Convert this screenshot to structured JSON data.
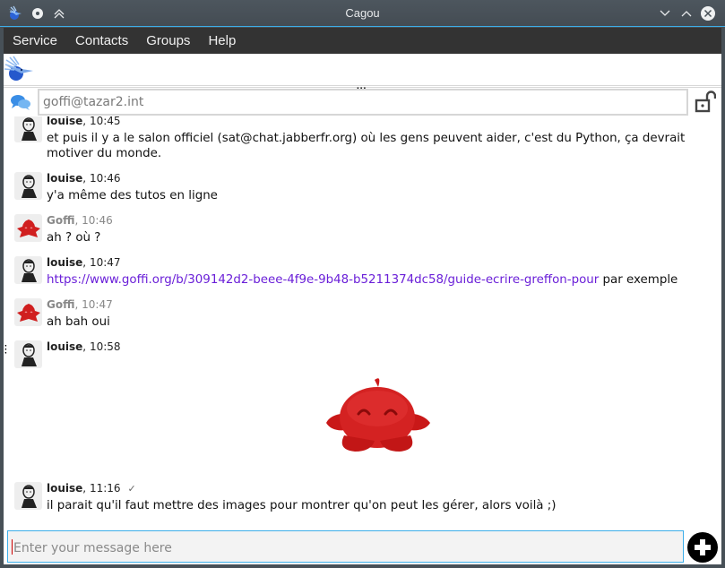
{
  "window": {
    "title": "Cagou",
    "controls": {
      "pin_icon": "pin-icon",
      "keep_above_icon": "keep-above-icon",
      "minimize_icon": "minimize-icon",
      "maximize_icon": "maximize-icon",
      "close_icon": "close-icon"
    }
  },
  "menubar": {
    "items": [
      {
        "label": "Service"
      },
      {
        "label": "Contacts"
      },
      {
        "label": "Groups"
      },
      {
        "label": "Help"
      }
    ]
  },
  "toolbar": {
    "logo_icon": "cagou-logo-icon",
    "splitter_handle": "..."
  },
  "chat": {
    "jid": "goffi@tazar2.int",
    "mode_icon": "chat-bubbles-icon",
    "encryption_icon": "unlocked-padlock-icon"
  },
  "messages": [
    {
      "nick": "louise",
      "time": "10:45",
      "sender": "louise",
      "text": "et puis il y a le salon officiel (sat@chat.jabberfr.org) où les gens peuvent aider, c'est du Python, ça devrait motiver du monde."
    },
    {
      "nick": "louise",
      "time": "10:46",
      "sender": "louise",
      "text": "y'a même des tutos en ligne"
    },
    {
      "nick": "Goffi",
      "time": "10:46",
      "sender": "goffi",
      "text": "ah ? où ?"
    },
    {
      "nick": "louise",
      "time": "10:47",
      "sender": "louise",
      "link": "https://www.goffi.org/b/309142d2-beee-4f9e-9b48-b5211374dc58/guide-ecrire-greffon-pour",
      "text_after": " par exemple"
    },
    {
      "nick": "Goffi",
      "time": "10:47",
      "sender": "goffi",
      "text": "ah bah oui"
    },
    {
      "nick": "louise",
      "time": "10:58",
      "sender": "louise",
      "image": "red-mascot-image"
    },
    {
      "nick": "louise",
      "time": "11:16",
      "sender": "louise",
      "delivered": "✓",
      "text": "il parait qu'il faut mettre des images pour montrer qu'on peut les gérer, alors voilà ;)"
    }
  ],
  "input": {
    "placeholder": "Enter your message here",
    "value": ""
  },
  "colors": {
    "accent": "#3daee9",
    "link": "#6a1fd8",
    "menubar_bg": "#333333",
    "mascot_red": "#d01f1f"
  }
}
